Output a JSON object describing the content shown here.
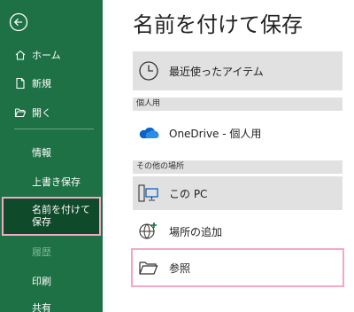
{
  "sidebar": {
    "items": [
      {
        "label": "ホーム"
      },
      {
        "label": "新規"
      },
      {
        "label": "開く"
      },
      {
        "label": "情報"
      },
      {
        "label": "上書き保存"
      },
      {
        "label": "名前を付けて保存"
      },
      {
        "label": "履歴"
      },
      {
        "label": "印刷"
      },
      {
        "label": "共有"
      }
    ]
  },
  "main": {
    "title": "名前を付けて保存",
    "recent_label": "最近使ったアイテム",
    "section_personal": "個人用",
    "onedrive_label": "OneDrive - 個人用",
    "section_other": "その他の場所",
    "this_pc_label": "この PC",
    "add_place_label": "場所の追加",
    "browse_label": "参照"
  },
  "colors": {
    "sidebar_bg": "#1e7145",
    "active_bg": "#0f4a2a",
    "highlight_border": "#f2a7c6",
    "onedrive_blue": "#0a64c8"
  }
}
